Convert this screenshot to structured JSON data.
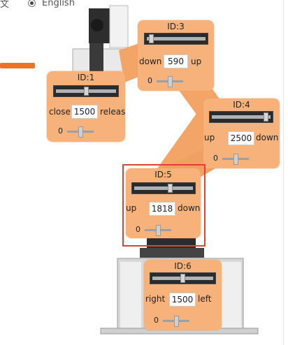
{
  "language": {
    "chinese_label": "中文",
    "english_label": "English",
    "selected": "English"
  },
  "joints": [
    {
      "id_label": "ID:1",
      "left_label": "close",
      "value": "1500",
      "right_label": "releas",
      "slider_min": "0",
      "bar_level": 0.5,
      "mini_level": 0.5
    },
    {
      "id_label": "ID:3",
      "left_label": "down",
      "value": "590",
      "right_label": "up",
      "slider_min": "0",
      "bar_level": 0.05,
      "mini_level": 0.5
    },
    {
      "id_label": "ID:4",
      "left_label": "up",
      "value": "2500",
      "right_label": "down",
      "slider_min": "0",
      "bar_level": 0.95,
      "mini_level": 0.5
    },
    {
      "id_label": "ID:5",
      "left_label": "up",
      "value": "1818",
      "right_label": "down",
      "slider_min": "0",
      "bar_level": 0.62,
      "mini_level": 0.5
    },
    {
      "id_label": "ID:6",
      "left_label": "right",
      "value": "1500",
      "right_label": "left",
      "slider_min": "0",
      "bar_level": 0.5,
      "mini_level": 0.5
    }
  ],
  "colors": {
    "panel": "#f6b27a",
    "arm": "#f3a467",
    "gripper_handle": "#e8742c",
    "highlight": "#e0403a",
    "bar": "#2b2b2b"
  }
}
